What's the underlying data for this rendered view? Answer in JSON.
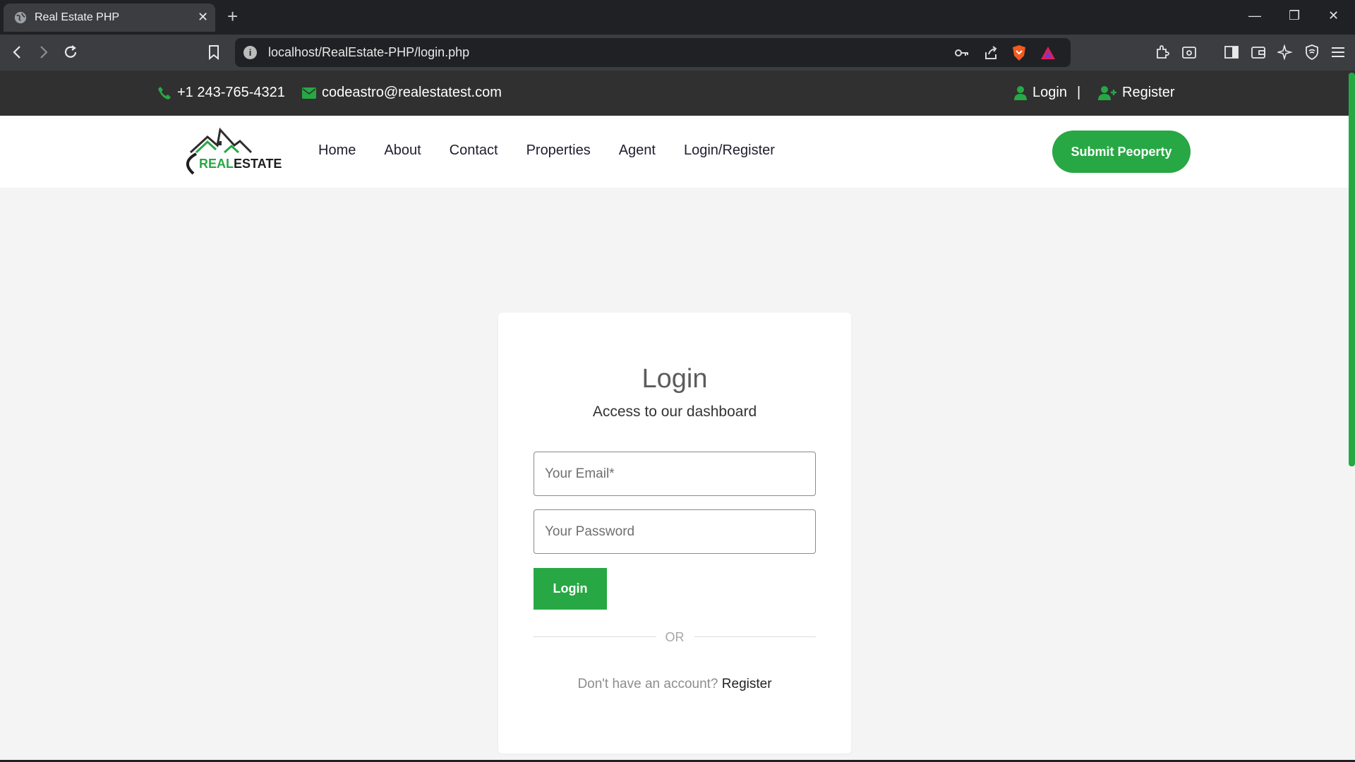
{
  "browser": {
    "tab_title": "Real Estate PHP",
    "url": "localhost/RealEstate-PHP/login.php"
  },
  "topbar": {
    "phone": "+1 243-765-4321",
    "email": "codeastro@realestatest.com",
    "login": "Login",
    "separator": "|",
    "register": "Register"
  },
  "header": {
    "logo": "REALESTATE",
    "nav": [
      "Home",
      "About",
      "Contact",
      "Properties",
      "Agent",
      "Login/Register"
    ],
    "submit_label": "Submit Peoperty"
  },
  "login_card": {
    "title": "Login",
    "subtitle": "Access to our dashboard",
    "email_placeholder": "Your Email*",
    "password_placeholder": "Your Password",
    "login_button": "Login",
    "or": "OR",
    "no_account": "Don't have an account?",
    "register_link": "Register"
  },
  "colors": {
    "accent_green": "#27a844",
    "topbar_bg": "#303030",
    "page_bg": "#f4f4f4"
  }
}
